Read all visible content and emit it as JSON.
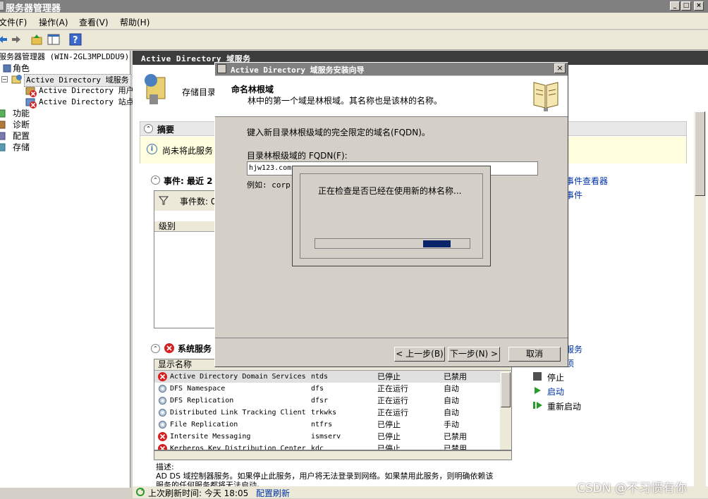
{
  "window": {
    "title": "服务器管理器"
  },
  "menu": [
    "文件(F)",
    "操作(A)",
    "查看(V)",
    "帮助(H)"
  ],
  "tree": {
    "root": "服务器管理器 (WIN-2GL3MPLDDU9)",
    "roles": "角色",
    "adds": "Active Directory 域服务",
    "ad_users": "Active Directory 用户",
    "ad_sites": "Active Directory 站点",
    "features": "功能",
    "diagnostics": "诊断",
    "config": "配置",
    "storage": "存储"
  },
  "main": {
    "header": "Active Directory 域服务",
    "desc_partial": "存储目录",
    "summary_title": "摘要",
    "summary_info": "尚未将此服务",
    "events_title": "事件: 最近 2",
    "events_count": "事件数: 0",
    "level_col": "级别",
    "event_viewer_link": "事件查看器",
    "events_link": "事件",
    "services_title": "系统服务",
    "display_name_col": "显示名称",
    "services_link1": "服务",
    "services_link2": "项",
    "stop": "停止",
    "start": "启动",
    "restart": "重新启动",
    "services": [
      {
        "name": "Active Directory Domain Services",
        "svc": "ntds",
        "status": "已停止",
        "startup": "已禁用",
        "icon": "error-icon"
      },
      {
        "name": "DFS Namespace",
        "svc": "dfs",
        "status": "正在运行",
        "startup": "自动",
        "icon": "gear-icon"
      },
      {
        "name": "DFS Replication",
        "svc": "dfsr",
        "status": "正在运行",
        "startup": "自动",
        "icon": "gear-icon"
      },
      {
        "name": "Distributed Link Tracking Client",
        "svc": "trkwks",
        "status": "正在运行",
        "startup": "自动",
        "icon": "gear-icon"
      },
      {
        "name": "File Replication",
        "svc": "ntfrs",
        "status": "已停止",
        "startup": "手动",
        "icon": "gear-icon"
      },
      {
        "name": "Intersite Messaging",
        "svc": "ismserv",
        "status": "已停止",
        "startup": "已禁用",
        "icon": "error-icon"
      },
      {
        "name": "Kerberos Key Distribution Center",
        "svc": "kdc",
        "status": "已停止",
        "startup": "已禁用",
        "icon": "error-icon"
      }
    ],
    "description_label": "描述:",
    "description_text": "AD DS 域控制器服务。如果停止此服务，用户将无法登录到网络。如果禁用此服务，则明确依赖该",
    "description_text2": "服务的任何服务都将无法启动。"
  },
  "status": {
    "refresh": "上次刷新时间: 今天 18:05",
    "config_refresh": "配置刷新"
  },
  "wizard": {
    "title": "Active Directory 域服务安装向导",
    "heading": "命名林根域",
    "subheading": "林中的第一个域是林根域。其名称也是该林的名称。",
    "instruction": "键入新目录林根级域的完全限定的域名(FQDN)。",
    "fqdn_label": "目录林根级域的 FQDN(F):",
    "fqdn_value": "hjw123.com",
    "example": "例如: corp.",
    "back": "< 上一步(B)",
    "next": "下一步(N) >",
    "cancel": "取消"
  },
  "progress": {
    "message": "正在检查是否已经在使用新的林名称...",
    "fraction": 0.18
  },
  "watermark": "CSDN @不习惯有你",
  "colors": {
    "progress_fill": "#0a246a",
    "link": "#0033aa",
    "error": "#d42020"
  }
}
